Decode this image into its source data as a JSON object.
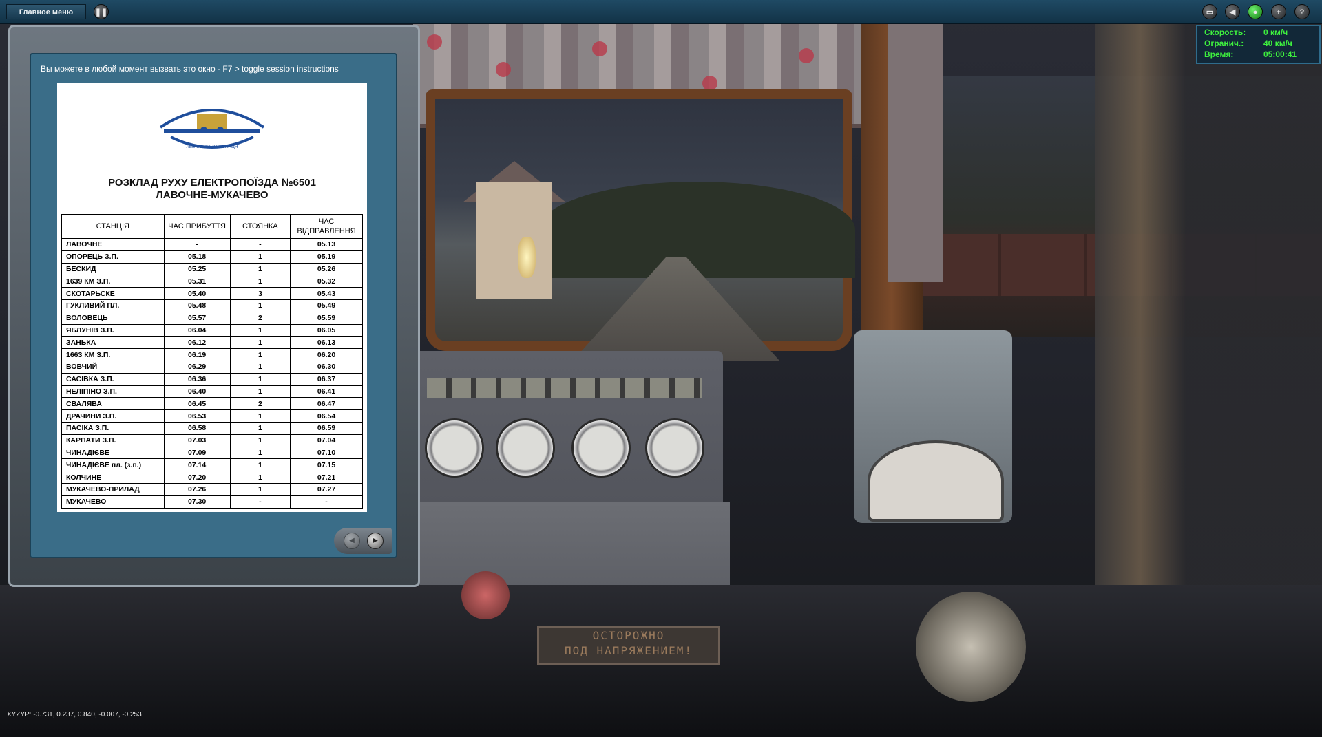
{
  "topbar": {
    "main_menu_label": "Главное меню",
    "pause_icon": "pause-icon",
    "right_buttons": [
      "window-icon",
      "back-icon",
      "green-status-icon",
      "add-icon",
      "help-icon"
    ],
    "right_glyphs": [
      "▭",
      "◀",
      "●",
      "+",
      "?"
    ]
  },
  "info": {
    "speed_label": "Скорость:",
    "speed_value": "0 км/ч",
    "limit_label": "Огранич.:",
    "limit_value": "40 км/ч",
    "time_label": "Время:",
    "time_value": "05:00:41",
    "text_color": "#3ef03e"
  },
  "instructions": {
    "hint": "Вы можете в любой момент вызвать это окно - F7 > toggle session instructions",
    "logo_year": "1861",
    "logo_text": "ЛЬВІВСЬКА ЗАЛІЗНИЦЯ",
    "title_line1": "РОЗКЛАД РУХУ ЕЛЕКТРОПОЇЗДА №6501",
    "title_line2": "ЛАВОЧНЕ-МУКАЧЕВО",
    "columns": {
      "station": "СТАНЦІЯ",
      "arrival": "ЧАС ПРИБУТТЯ",
      "stop": "СТОЯНКА",
      "departure": "ЧАС ВІДПРАВЛЕННЯ"
    },
    "rows": [
      [
        "ЛАВОЧНЕ",
        "-",
        "-",
        "05.13"
      ],
      [
        "ОПОРЕЦЬ З.П.",
        "05.18",
        "1",
        "05.19"
      ],
      [
        "БЕСКИД",
        "05.25",
        "1",
        "05.26"
      ],
      [
        "1639 КМ З.П.",
        "05.31",
        "1",
        "05.32"
      ],
      [
        "СКОТАРЬСКЕ",
        "05.40",
        "3",
        "05.43"
      ],
      [
        "ГУКЛИВИЙ ПЛ.",
        "05.48",
        "1",
        "05.49"
      ],
      [
        "ВОЛОВЕЦЬ",
        "05.57",
        "2",
        "05.59"
      ],
      [
        "ЯБЛУНІВ З.П.",
        "06.04",
        "1",
        "06.05"
      ],
      [
        "ЗАНЬКА",
        "06.12",
        "1",
        "06.13"
      ],
      [
        "1663 КМ З.П.",
        "06.19",
        "1",
        "06.20"
      ],
      [
        "ВОВЧИЙ",
        "06.29",
        "1",
        "06.30"
      ],
      [
        "САСІВКА З.П.",
        "06.36",
        "1",
        "06.37"
      ],
      [
        "НЕЛІПІНО З.П.",
        "06.40",
        "1",
        "06.41"
      ],
      [
        "СВАЛЯВА",
        "06.45",
        "2",
        "06.47"
      ],
      [
        "ДРАЧИНИ З.П.",
        "06.53",
        "1",
        "06.54"
      ],
      [
        "ПАСІКА З.П.",
        "06.58",
        "1",
        "06.59"
      ],
      [
        "КАРПАТИ З.П.",
        "07.03",
        "1",
        "07.04"
      ],
      [
        "ЧИНАДІЄВЕ",
        "07.09",
        "1",
        "07.10"
      ],
      [
        "ЧИНАДІЄВЕ пл. (з.п.)",
        "07.14",
        "1",
        "07.15"
      ],
      [
        "КОЛЧИНЕ",
        "07.20",
        "1",
        "07.21"
      ],
      [
        "МУКАЧЕВО-ПРИЛАД",
        "07.26",
        "1",
        "07.27"
      ],
      [
        "МУКАЧЕВО",
        "07.30",
        "-",
        "-"
      ]
    ],
    "nav_prev_glyph": "◀",
    "nav_next_glyph": "▶"
  },
  "scene": {
    "warning_sign_line1": "ОСТОРОЖНО",
    "warning_sign_line2": "ПОД НАПРЯЖЕНИЕМ!"
  },
  "coords_readout": "XYZYP: -0.731, 0.237, 0.840, -0.007, -0.253"
}
